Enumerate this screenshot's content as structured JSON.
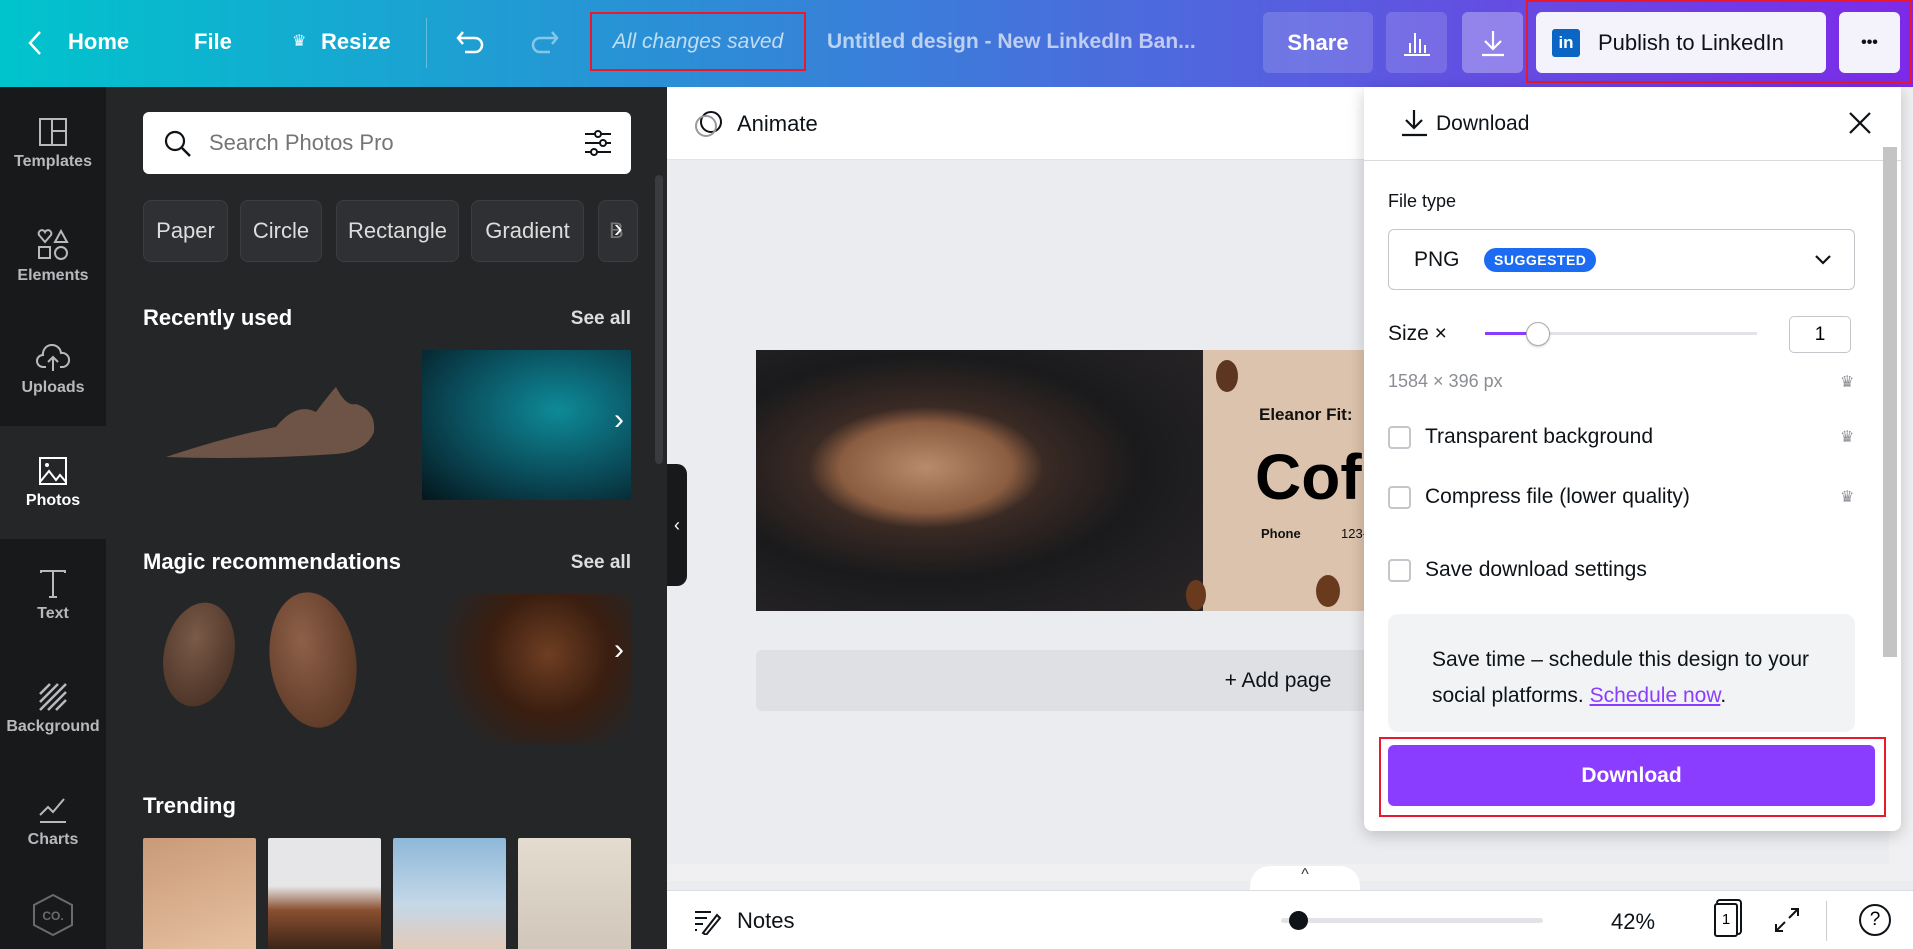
{
  "topbar": {
    "home": "Home",
    "file": "File",
    "resize": "Resize",
    "saved_status": "All changes saved",
    "design_title": "Untitled design - New LinkedIn Ban...",
    "share": "Share",
    "publish": "Publish to LinkedIn",
    "more": "•••"
  },
  "rail": {
    "items": [
      {
        "label": "Templates"
      },
      {
        "label": "Elements"
      },
      {
        "label": "Uploads"
      },
      {
        "label": "Photos",
        "active": true
      },
      {
        "label": "Text"
      },
      {
        "label": "Background"
      },
      {
        "label": "Charts"
      }
    ],
    "brand_logo": "CO."
  },
  "panel": {
    "search_placeholder": "Search Photos Pro",
    "chips": [
      "Paper",
      "Circle",
      "Rectangle",
      "Gradient",
      "B"
    ],
    "sections": [
      {
        "title": "Recently used",
        "see_all": "See all"
      },
      {
        "title": "Magic recommendations",
        "see_all": "See all"
      },
      {
        "title": "Trending"
      }
    ]
  },
  "canvas": {
    "animate": "Animate",
    "add_page": "+ Add page",
    "design": {
      "name": "Eleanor Fit:",
      "headline": "Cof",
      "phone_label": "Phone",
      "phone_value": "123-"
    }
  },
  "bottombar": {
    "notes": "Notes",
    "zoom": "42%",
    "zoom_fraction": 0.08,
    "page_count": "1",
    "help": "?"
  },
  "download_panel": {
    "title": "Download",
    "file_type_label": "File type",
    "file_type": "PNG",
    "badge": "SUGGESTED",
    "size_label": "Size ×",
    "size_value": "1",
    "size_slider_fraction": 0.17,
    "dimensions": "1584 × 396 px",
    "options": [
      {
        "label": "Transparent background",
        "checked": false,
        "pro": true
      },
      {
        "label": "Compress file (lower quality)",
        "checked": false,
        "pro": true
      },
      {
        "label": "Save download settings",
        "checked": false,
        "pro": false
      }
    ],
    "promo_text": "Save time – schedule this design to your social platforms.",
    "promo_link": "Schedule now",
    "promo_end": ".",
    "download_button": "Download"
  },
  "colors": {
    "accent": "#8b3dff",
    "badge": "#1b6cf2",
    "highlight": "#e8192c"
  }
}
